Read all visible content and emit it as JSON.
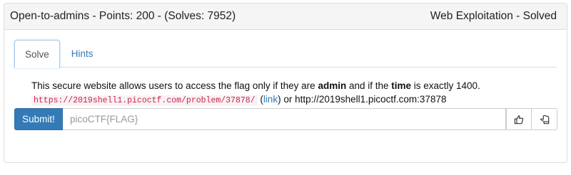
{
  "header": {
    "challenge_info": "Open-to-admins - Points: 200 - (Solves: 7952)",
    "category_status": "Web Exploitation - Solved"
  },
  "tabs": [
    {
      "label": "Solve",
      "active": true
    },
    {
      "label": "Hints",
      "active": false
    }
  ],
  "description": {
    "part1": "This secure website allows users to access the flag only if they are ",
    "bold1": "admin",
    "part2": " and if the ",
    "bold2": "time",
    "part3": " is exactly 1400.",
    "code_url": "https://2019shell1.picoctf.com/problem/37878/",
    "paren_open": " (",
    "link_text": "link",
    "paren_close": ") or http://2019shell1.picoctf.com:37878"
  },
  "form": {
    "submit_label": "Submit!",
    "flag_placeholder": "picoCTF{FLAG}"
  },
  "icons": {
    "like": "thumbs-up-icon",
    "dislike": "thumbs-down-icon"
  },
  "colors": {
    "primary": "#337ab7",
    "code": "#c7254e"
  }
}
